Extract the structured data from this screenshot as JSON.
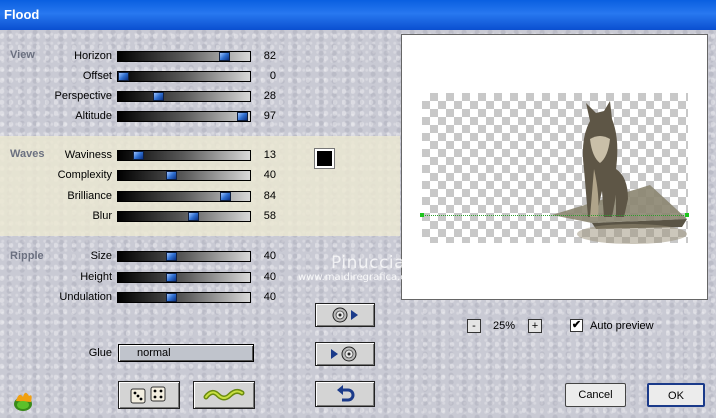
{
  "window": {
    "title": "Flood"
  },
  "sections": {
    "view": "View",
    "waves": "Waves",
    "ripple": "Ripple"
  },
  "sliders": {
    "horizon": {
      "label": "Horizon",
      "value": 82,
      "fraction": 0.8
    },
    "offset": {
      "label": "Offset",
      "value": 0,
      "fraction": 0.04
    },
    "perspective": {
      "label": "Perspective",
      "value": 28,
      "fraction": 0.3
    },
    "altitude": {
      "label": "Altitude",
      "value": 97,
      "fraction": 0.94
    },
    "waviness": {
      "label": "Waviness",
      "value": 13,
      "fraction": 0.15
    },
    "complexity": {
      "label": "Complexity",
      "value": 40,
      "fraction": 0.4
    },
    "brilliance": {
      "label": "Brilliance",
      "value": 84,
      "fraction": 0.81
    },
    "blur": {
      "label": "Blur",
      "value": 58,
      "fraction": 0.57
    },
    "size": {
      "label": "Size",
      "value": 40,
      "fraction": 0.4
    },
    "height": {
      "label": "Height",
      "value": 40,
      "fraction": 0.4
    },
    "undulation": {
      "label": "Undulation",
      "value": 40,
      "fraction": 0.4
    }
  },
  "waves_color": "#000000",
  "glue": {
    "label": "Glue",
    "value": "normal"
  },
  "zoom": {
    "value": "25%",
    "minus": "-",
    "plus": "+"
  },
  "auto_preview": {
    "label": "Auto preview",
    "checked": true,
    "mark": "✔"
  },
  "buttons": {
    "cancel": "Cancel",
    "ok": "OK"
  },
  "watermark": {
    "line1": "Pinuccia",
    "line2": "www.maidiregrafica.eu"
  },
  "icons": [
    "plugin-logo-icon",
    "randomize-dice-icon",
    "wave-icon",
    "load-preset-icon",
    "save-preset-icon",
    "reset-icon",
    "wolf-image"
  ]
}
